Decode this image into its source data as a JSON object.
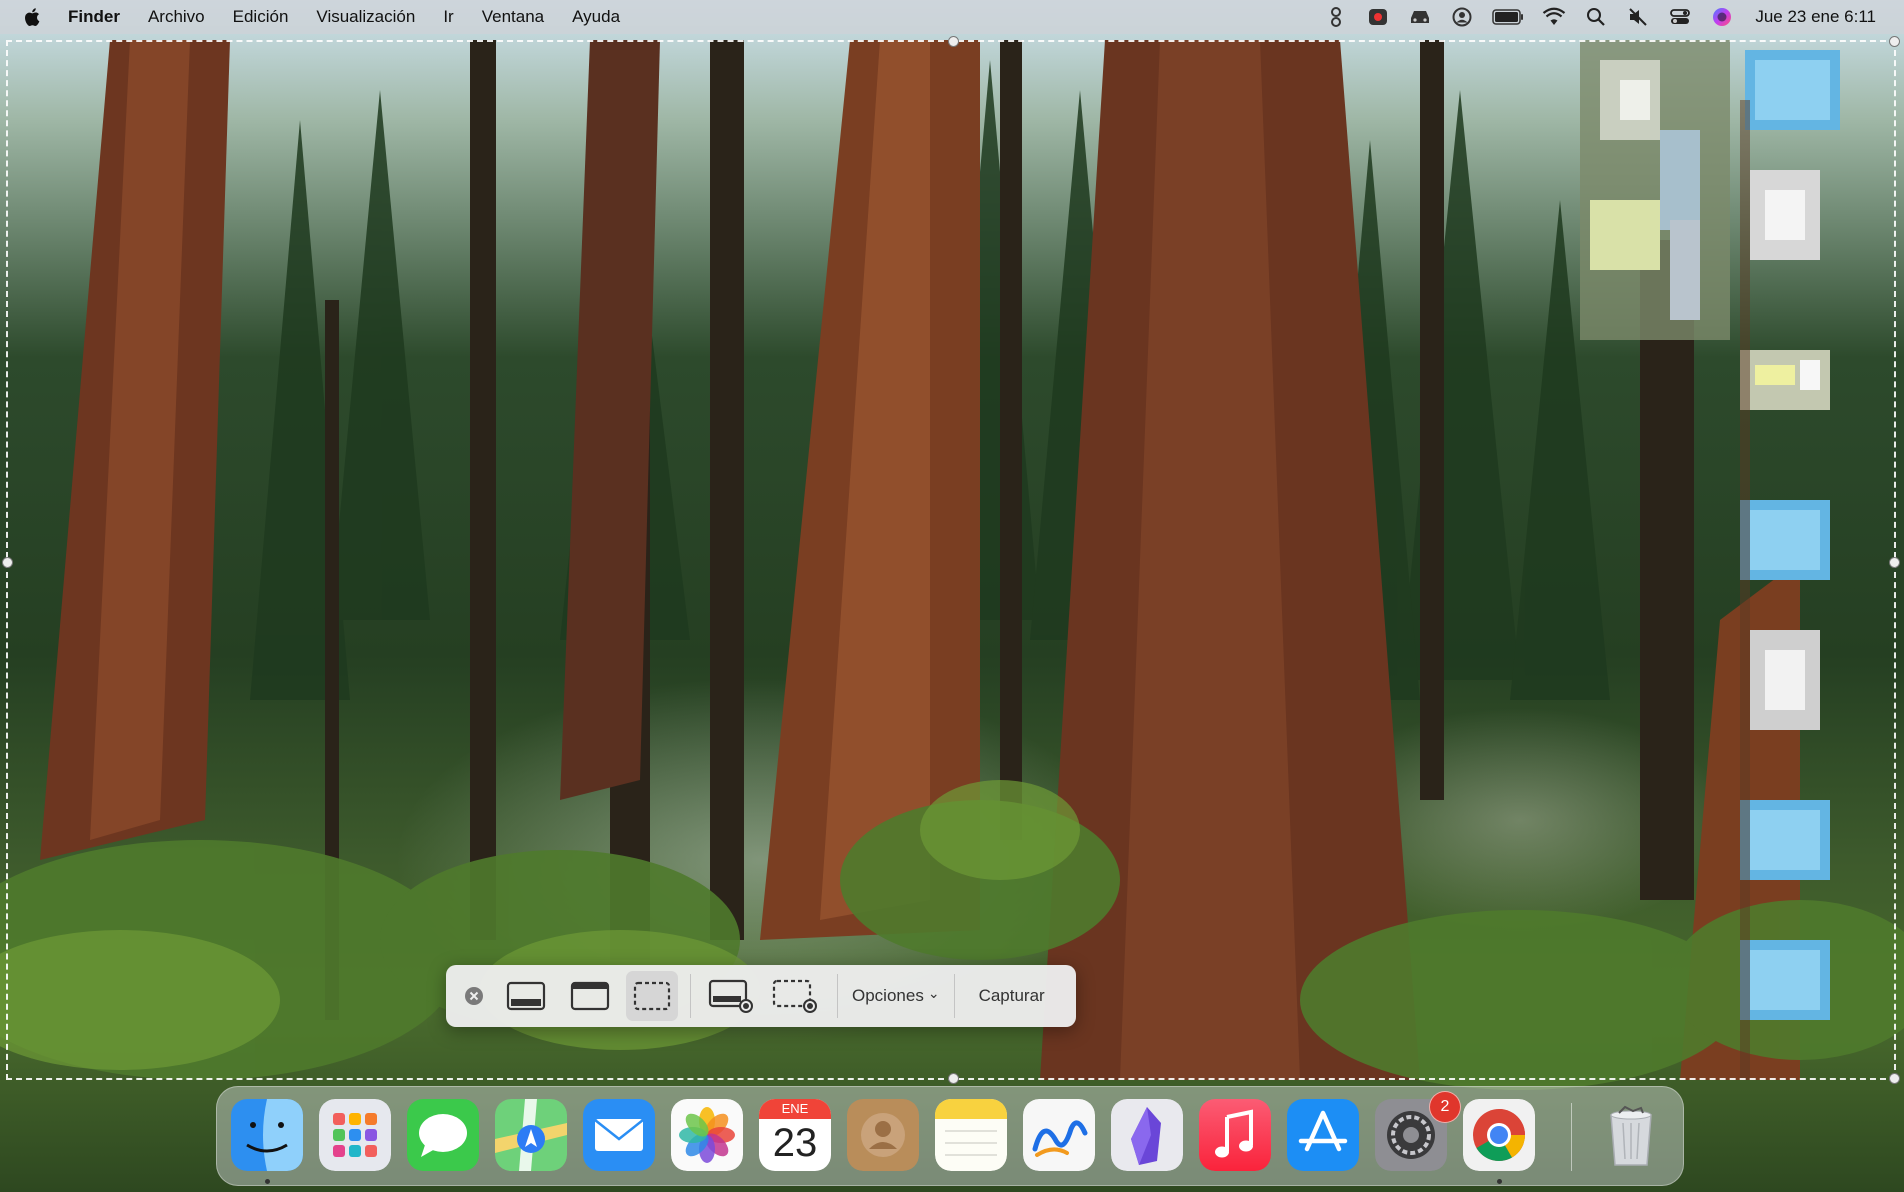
{
  "menubar": {
    "app_name": "Finder",
    "items": [
      "Archivo",
      "Edición",
      "Visualización",
      "Ir",
      "Ventana",
      "Ayuda"
    ],
    "status_icons": [
      "script-icon",
      "screen-record-icon",
      "car-icon",
      "user-icon",
      "battery-icon",
      "wifi-icon",
      "search-icon",
      "mute-icon",
      "control-center-icon",
      "siri-icon"
    ],
    "clock": "Jue 23 ene 6:11"
  },
  "toolbar": {
    "buttons": [
      "close-icon",
      "capture-screen-icon",
      "capture-window-icon",
      "capture-selection-icon",
      "record-screen-icon",
      "record-selection-icon"
    ],
    "selected": "capture-selection-icon",
    "options_label": "Opciones",
    "options_chevron": "⌄",
    "capture_label": "Capturar"
  },
  "dock": {
    "apps": [
      "Finder",
      "Launchpad",
      "Mensajes",
      "Mapas",
      "Mail",
      "Fotos",
      "Calendario",
      "Contactos",
      "Notas",
      "Freeform",
      "Obsidian",
      "Música",
      "App Store",
      "Configuración del Sistema",
      "Chrome",
      "Papelera"
    ],
    "calendar": {
      "month": "ENE",
      "day": "23"
    },
    "settings_badge": "2",
    "running": [
      "Finder",
      "Chrome"
    ]
  },
  "colors": {
    "accent": "#0a84ff",
    "badge": "#e0362c"
  }
}
